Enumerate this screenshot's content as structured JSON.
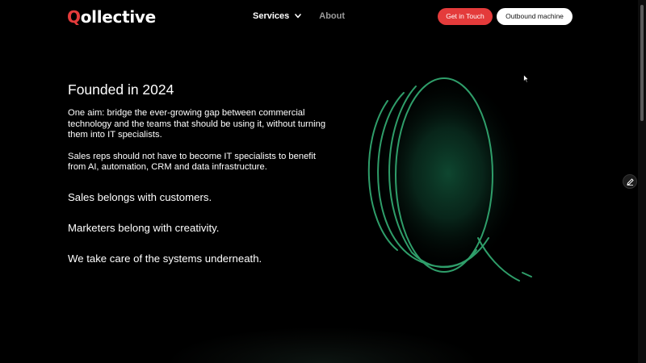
{
  "header": {
    "logo_q": "Q",
    "logo_rest": "ollective",
    "nav": {
      "services_label": "Services",
      "about_label": "About"
    },
    "cta_primary": "Get in Touch",
    "cta_secondary": "Outbound machine"
  },
  "main": {
    "heading": "Founded in 2024",
    "paragraph_1": "One aim: bridge the ever-growing gap between commercial technology and the teams that should be using it, without turning them into IT specialists.",
    "paragraph_2": "Sales reps should not have to become IT specialists to benefit from AI, automation, CRM and data infrastructure.",
    "taglines": [
      "Sales belongs with customers.",
      "Marketers belong with creativity.",
      "We take care of the systems underneath."
    ]
  },
  "colors": {
    "brand_red": "#e43b3b",
    "accent_green": "#2f9e6a",
    "background": "#000000"
  },
  "icons": {
    "services_dropdown": "chevron-down-icon",
    "edit": "pencil-icon",
    "graphic": "q-outline-graphic",
    "cursor": "mouse-cursor-icon"
  }
}
